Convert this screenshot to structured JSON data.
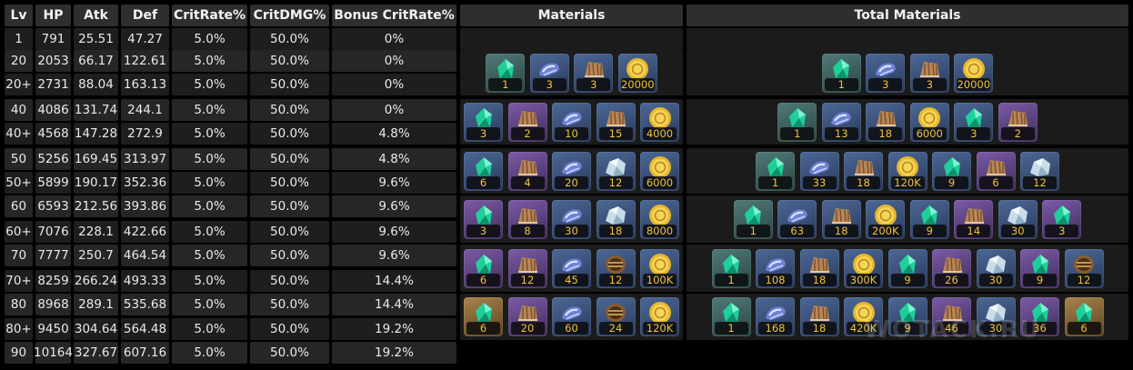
{
  "headers": {
    "lv": "Lv",
    "hp": "HP",
    "atk": "Atk",
    "def": "Def",
    "crit_rate": "CritRate%",
    "crit_dmg": "CritDMG%",
    "bonus_crit_rate": "Bonus CritRate%",
    "materials": "Materials",
    "total_materials": "Total Materials"
  },
  "rows": [
    {
      "lv": "1",
      "hp": "791",
      "atk": "25.51",
      "def": "47.27",
      "crit_rate": "5.0%",
      "crit_dmg": "50.0%",
      "bonus": "0%"
    },
    {
      "lv": "20",
      "hp": "2053",
      "atk": "66.17",
      "def": "122.61",
      "crit_rate": "5.0%",
      "crit_dmg": "50.0%",
      "bonus": "0%"
    },
    {
      "lv": "20+",
      "hp": "2731",
      "atk": "88.04",
      "def": "163.13",
      "crit_rate": "5.0%",
      "crit_dmg": "50.0%",
      "bonus": "0%"
    },
    {
      "lv": "40",
      "hp": "4086",
      "atk": "131.74",
      "def": "244.1",
      "crit_rate": "5.0%",
      "crit_dmg": "50.0%",
      "bonus": "0%"
    },
    {
      "lv": "40+",
      "hp": "4568",
      "atk": "147.28",
      "def": "272.9",
      "crit_rate": "5.0%",
      "crit_dmg": "50.0%",
      "bonus": "4.8%"
    },
    {
      "lv": "50",
      "hp": "5256",
      "atk": "169.45",
      "def": "313.97",
      "crit_rate": "5.0%",
      "crit_dmg": "50.0%",
      "bonus": "4.8%"
    },
    {
      "lv": "50+",
      "hp": "5899",
      "atk": "190.17",
      "def": "352.36",
      "crit_rate": "5.0%",
      "crit_dmg": "50.0%",
      "bonus": "9.6%"
    },
    {
      "lv": "60",
      "hp": "6593",
      "atk": "212.56",
      "def": "393.86",
      "crit_rate": "5.0%",
      "crit_dmg": "50.0%",
      "bonus": "9.6%"
    },
    {
      "lv": "60+",
      "hp": "7076",
      "atk": "228.1",
      "def": "422.66",
      "crit_rate": "5.0%",
      "crit_dmg": "50.0%",
      "bonus": "9.6%"
    },
    {
      "lv": "70",
      "hp": "7777",
      "atk": "250.7",
      "def": "464.54",
      "crit_rate": "5.0%",
      "crit_dmg": "50.0%",
      "bonus": "9.6%"
    },
    {
      "lv": "70+",
      "hp": "8259",
      "atk": "266.24",
      "def": "493.33",
      "crit_rate": "5.0%",
      "crit_dmg": "50.0%",
      "bonus": "14.4%"
    },
    {
      "lv": "80",
      "hp": "8968",
      "atk": "289.1",
      "def": "535.68",
      "crit_rate": "5.0%",
      "crit_dmg": "50.0%",
      "bonus": "14.4%"
    },
    {
      "lv": "80+",
      "hp": "9450",
      "atk": "304.64",
      "def": "564.48",
      "crit_rate": "5.0%",
      "crit_dmg": "50.0%",
      "bonus": "19.2%"
    },
    {
      "lv": "90",
      "hp": "10164",
      "atk": "327.67",
      "def": "607.16",
      "crit_rate": "5.0%",
      "crit_dmg": "50.0%",
      "bonus": "19.2%"
    }
  ],
  "materials": [
    [
      {
        "icon": "green-crystal-icon",
        "count": "1",
        "rarity": "teal"
      },
      {
        "icon": "blue-ore-icon",
        "count": "3",
        "rarity": "blue"
      },
      {
        "icon": "brown-shell-icon",
        "count": "3",
        "rarity": "blue"
      },
      {
        "icon": "gold-coin-icon",
        "count": "20000",
        "rarity": "blue"
      }
    ],
    [
      {
        "icon": "green-crystal-icon",
        "count": "3",
        "rarity": "blue"
      },
      {
        "icon": "brown-shell-icon",
        "count": "2",
        "rarity": "purple"
      },
      {
        "icon": "blue-ore-icon",
        "count": "10",
        "rarity": "blue"
      },
      {
        "icon": "brown-shell-icon",
        "count": "15",
        "rarity": "blue"
      },
      {
        "icon": "gold-coin-icon",
        "count": "4000",
        "rarity": "blue"
      }
    ],
    [
      {
        "icon": "green-crystal-icon",
        "count": "6",
        "rarity": "blue"
      },
      {
        "icon": "brown-shell-icon",
        "count": "4",
        "rarity": "purple"
      },
      {
        "icon": "blue-ore-icon",
        "count": "20",
        "rarity": "blue"
      },
      {
        "icon": "silver-ore-icon",
        "count": "12",
        "rarity": "blue"
      },
      {
        "icon": "gold-coin-icon",
        "count": "6000",
        "rarity": "blue"
      }
    ],
    [
      {
        "icon": "green-crystal-icon",
        "count": "3",
        "rarity": "purple"
      },
      {
        "icon": "brown-shell-icon",
        "count": "8",
        "rarity": "purple"
      },
      {
        "icon": "blue-ore-icon",
        "count": "30",
        "rarity": "blue"
      },
      {
        "icon": "silver-ore-icon",
        "count": "18",
        "rarity": "blue"
      },
      {
        "icon": "gold-coin-icon",
        "count": "8000",
        "rarity": "blue"
      }
    ],
    [
      {
        "icon": "green-crystal-icon",
        "count": "6",
        "rarity": "purple"
      },
      {
        "icon": "brown-shell-icon",
        "count": "12",
        "rarity": "purple"
      },
      {
        "icon": "blue-ore-icon",
        "count": "45",
        "rarity": "blue"
      },
      {
        "icon": "gold-ring-icon",
        "count": "12",
        "rarity": "blue"
      },
      {
        "icon": "gold-coin-icon",
        "count": "100K",
        "rarity": "blue"
      }
    ],
    [
      {
        "icon": "green-crystal-icon",
        "count": "6",
        "rarity": "gold"
      },
      {
        "icon": "brown-shell-icon",
        "count": "20",
        "rarity": "purple"
      },
      {
        "icon": "blue-ore-icon",
        "count": "60",
        "rarity": "blue"
      },
      {
        "icon": "gold-ring-icon",
        "count": "24",
        "rarity": "blue"
      },
      {
        "icon": "gold-coin-icon",
        "count": "120K",
        "rarity": "blue"
      }
    ]
  ],
  "total_materials": [
    [
      {
        "icon": "green-crystal-icon",
        "count": "1",
        "rarity": "teal"
      },
      {
        "icon": "blue-ore-icon",
        "count": "3",
        "rarity": "blue"
      },
      {
        "icon": "brown-shell-icon",
        "count": "3",
        "rarity": "blue"
      },
      {
        "icon": "gold-coin-icon",
        "count": "20000",
        "rarity": "blue"
      }
    ],
    [
      {
        "icon": "green-crystal-icon",
        "count": "1",
        "rarity": "teal"
      },
      {
        "icon": "blue-ore-icon",
        "count": "13",
        "rarity": "blue"
      },
      {
        "icon": "brown-shell-icon",
        "count": "18",
        "rarity": "blue"
      },
      {
        "icon": "gold-coin-icon",
        "count": "6000",
        "rarity": "blue"
      },
      {
        "icon": "green-crystal-icon",
        "count": "3",
        "rarity": "blue"
      },
      {
        "icon": "brown-shell-icon",
        "count": "2",
        "rarity": "purple"
      }
    ],
    [
      {
        "icon": "green-crystal-icon",
        "count": "1",
        "rarity": "teal"
      },
      {
        "icon": "blue-ore-icon",
        "count": "33",
        "rarity": "blue"
      },
      {
        "icon": "brown-shell-icon",
        "count": "18",
        "rarity": "blue"
      },
      {
        "icon": "gold-coin-icon",
        "count": "120K",
        "rarity": "blue"
      },
      {
        "icon": "green-crystal-icon",
        "count": "9",
        "rarity": "blue"
      },
      {
        "icon": "brown-shell-icon",
        "count": "6",
        "rarity": "purple"
      },
      {
        "icon": "silver-ore-icon",
        "count": "12",
        "rarity": "blue"
      }
    ],
    [
      {
        "icon": "green-crystal-icon",
        "count": "1",
        "rarity": "teal"
      },
      {
        "icon": "blue-ore-icon",
        "count": "63",
        "rarity": "blue"
      },
      {
        "icon": "brown-shell-icon",
        "count": "18",
        "rarity": "blue"
      },
      {
        "icon": "gold-coin-icon",
        "count": "200K",
        "rarity": "blue"
      },
      {
        "icon": "green-crystal-icon",
        "count": "9",
        "rarity": "blue"
      },
      {
        "icon": "brown-shell-icon",
        "count": "14",
        "rarity": "purple"
      },
      {
        "icon": "silver-ore-icon",
        "count": "30",
        "rarity": "blue"
      },
      {
        "icon": "green-crystal-icon",
        "count": "3",
        "rarity": "purple"
      }
    ],
    [
      {
        "icon": "green-crystal-icon",
        "count": "1",
        "rarity": "teal"
      },
      {
        "icon": "blue-ore-icon",
        "count": "108",
        "rarity": "blue"
      },
      {
        "icon": "brown-shell-icon",
        "count": "18",
        "rarity": "blue"
      },
      {
        "icon": "gold-coin-icon",
        "count": "300K",
        "rarity": "blue"
      },
      {
        "icon": "green-crystal-icon",
        "count": "9",
        "rarity": "blue"
      },
      {
        "icon": "brown-shell-icon",
        "count": "26",
        "rarity": "purple"
      },
      {
        "icon": "silver-ore-icon",
        "count": "30",
        "rarity": "blue"
      },
      {
        "icon": "green-crystal-icon",
        "count": "9",
        "rarity": "purple"
      },
      {
        "icon": "gold-ring-icon",
        "count": "12",
        "rarity": "blue"
      }
    ],
    [
      {
        "icon": "green-crystal-icon",
        "count": "1",
        "rarity": "teal"
      },
      {
        "icon": "blue-ore-icon",
        "count": "168",
        "rarity": "blue"
      },
      {
        "icon": "brown-shell-icon",
        "count": "18",
        "rarity": "blue"
      },
      {
        "icon": "gold-coin-icon",
        "count": "420K",
        "rarity": "blue"
      },
      {
        "icon": "green-crystal-icon",
        "count": "9",
        "rarity": "blue"
      },
      {
        "icon": "brown-shell-icon",
        "count": "46",
        "rarity": "purple"
      },
      {
        "icon": "silver-ore-icon",
        "count": "30",
        "rarity": "blue"
      },
      {
        "icon": "green-crystal-icon",
        "count": "36",
        "rarity": "purple"
      },
      {
        "icon": "green-crystal-icon",
        "count": "6",
        "rarity": "gold"
      }
    ]
  ],
  "watermark": "WOTACK.RU"
}
